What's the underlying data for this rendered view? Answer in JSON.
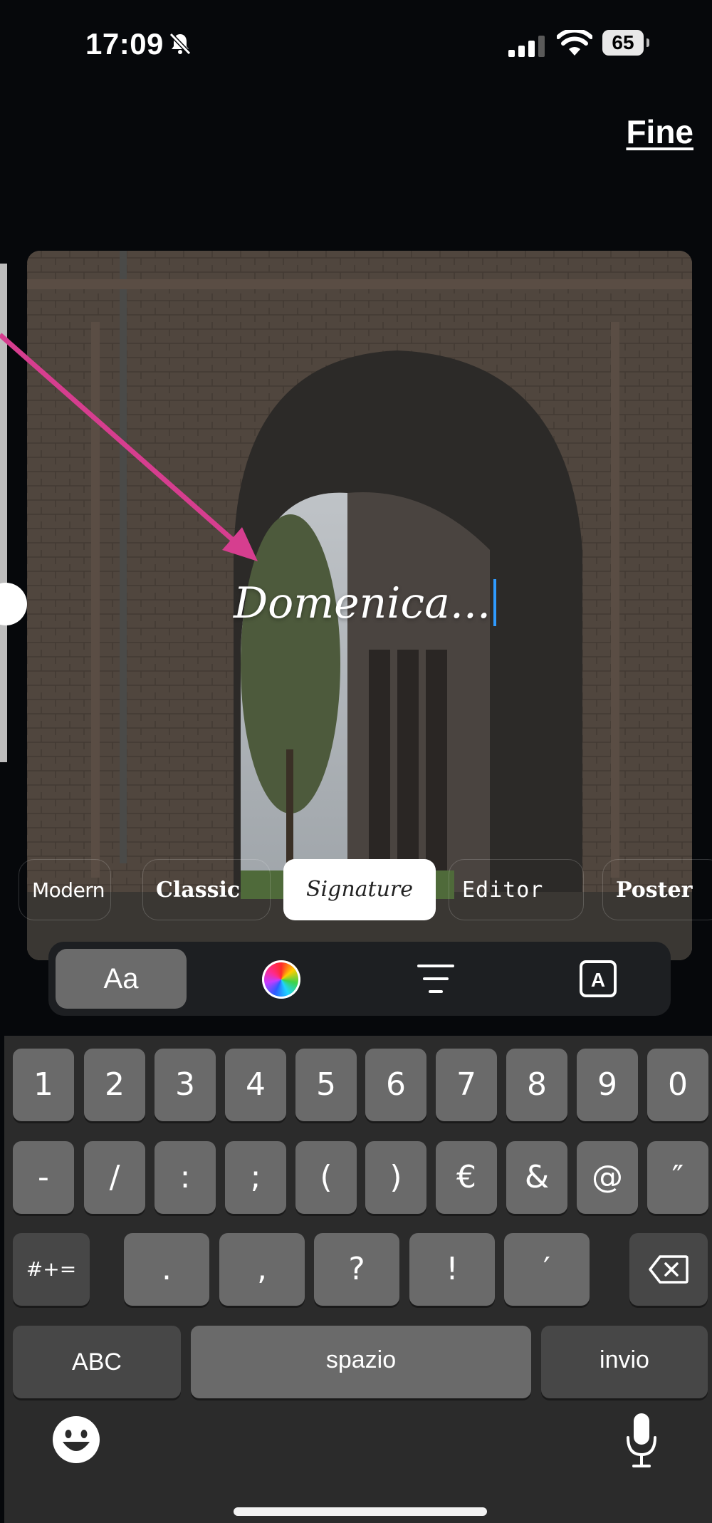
{
  "status_bar": {
    "time": "17:09",
    "battery_level": "65",
    "icons": [
      "bell-slash-icon",
      "cellular-signal-icon",
      "wifi-icon",
      "battery-icon"
    ]
  },
  "header": {
    "done_label": "Fine"
  },
  "canvas": {
    "text": "Domenica...",
    "annotation_arrow_color": "#d63e8f"
  },
  "font_styles": {
    "selected": "Signature",
    "options": [
      "Modern",
      "Classic",
      "Signature",
      "Editor",
      "Poster"
    ]
  },
  "toolbar": {
    "font_label": "Aa",
    "icons": [
      "color-wheel-icon",
      "align-icon",
      "text-style-icon"
    ]
  },
  "keyboard": {
    "row1": [
      "1",
      "2",
      "3",
      "4",
      "5",
      "6",
      "7",
      "8",
      "9",
      "0"
    ],
    "row2": [
      "-",
      "/",
      ":",
      ";",
      "(",
      ")",
      "€",
      "&",
      "@",
      "″"
    ],
    "row3": [
      "#+=",
      ".",
      ",",
      "?",
      "!",
      "′"
    ],
    "abc_label": "ABC",
    "space_label": "spazio",
    "return_label": "invio"
  },
  "colors": {
    "background": "#06080b",
    "keyboard": "#2b2b2b",
    "key": "#6a6a6a",
    "caret": "#2f9bff"
  }
}
